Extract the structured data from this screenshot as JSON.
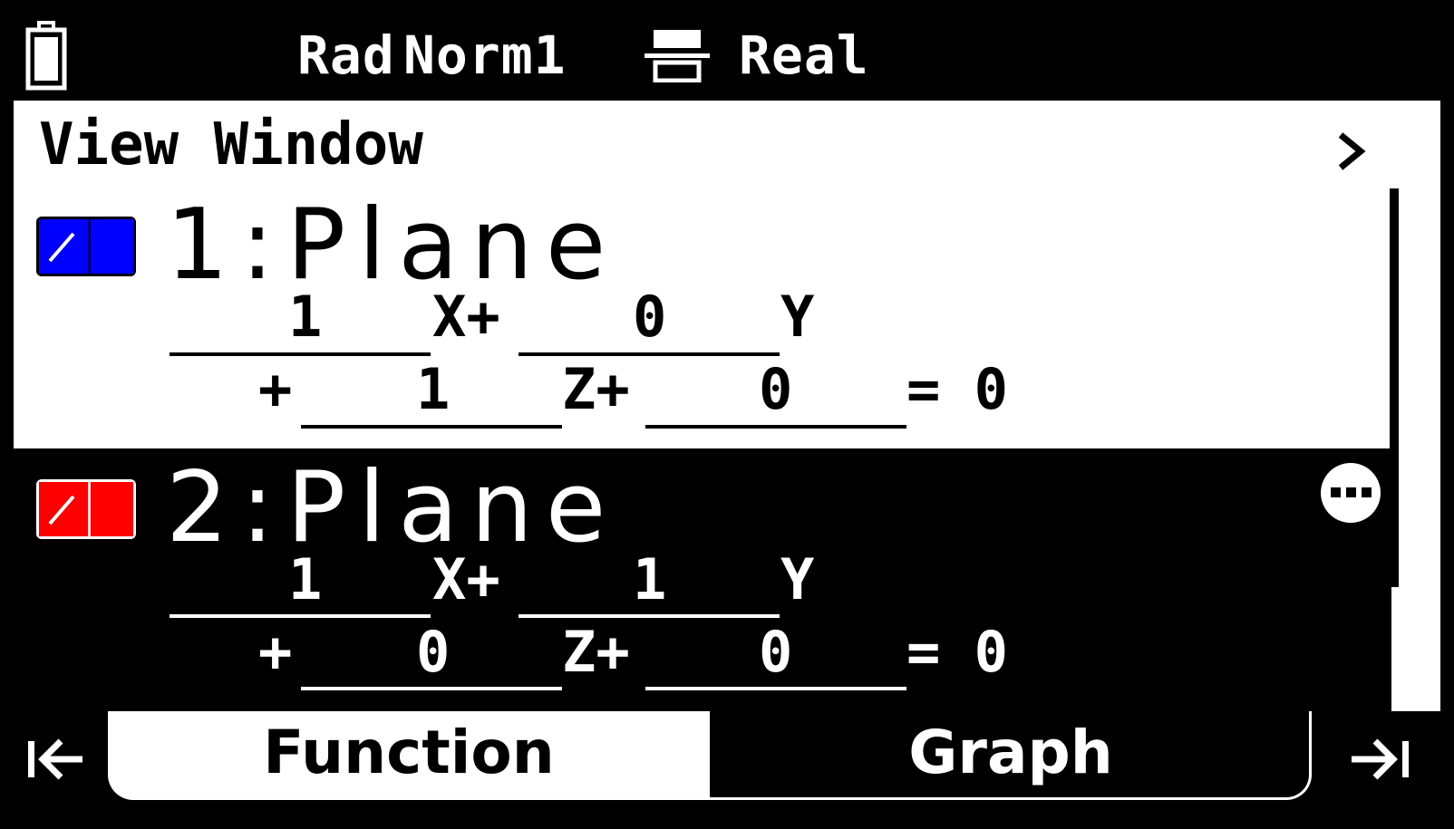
{
  "status_bar": {
    "angle_mode": "Rad",
    "display_mode": "Norm1",
    "complex_mode": "Real",
    "battery_icon": "battery-icon",
    "fraction_icon": "fraction-format-icon"
  },
  "view_window": {
    "label": "View Window",
    "arrow_icon": "chevron-right-icon"
  },
  "entries": [
    {
      "index": "1",
      "title": "1:Plane",
      "color": "#0000ff",
      "selected": false,
      "coefficients": {
        "a": "1",
        "b": "0",
        "c": "1",
        "d": "0"
      },
      "labels": {
        "x": "X+",
        "y": "Y",
        "plus": "+",
        "z": "Z+",
        "equals": "= 0"
      }
    },
    {
      "index": "2",
      "title": "2:Plane",
      "color": "#ff0000",
      "selected": true,
      "coefficients": {
        "a": "1",
        "b": "1",
        "c": "0",
        "d": "0"
      },
      "labels": {
        "x": "X+",
        "y": "Y",
        "plus": "+",
        "z": "Z+",
        "equals": "= 0"
      }
    }
  ],
  "tabs": {
    "function": "Function",
    "graph": "Graph",
    "first_icon": "jump-to-first-icon",
    "last_icon": "jump-to-last-icon",
    "more_icon": "more-options-icon"
  }
}
